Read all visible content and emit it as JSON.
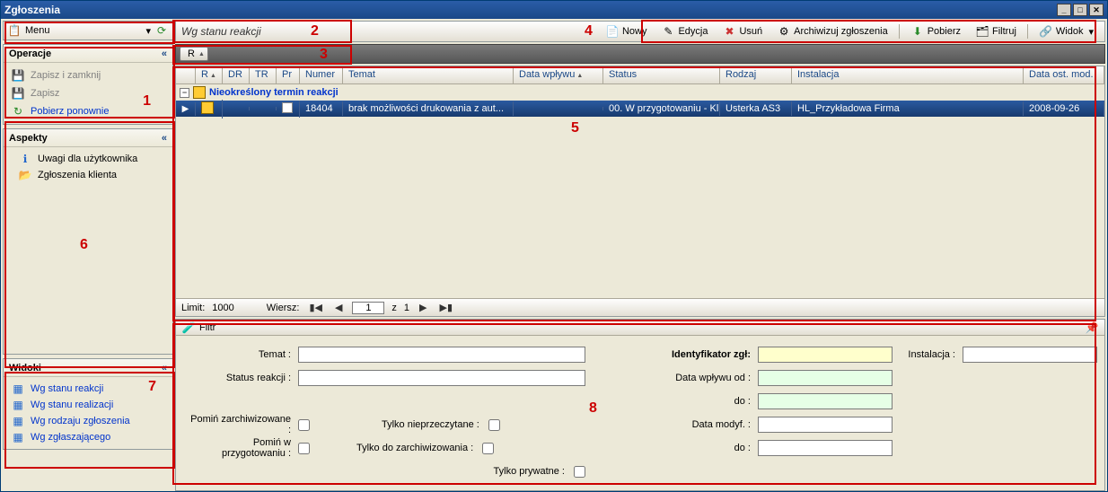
{
  "window": {
    "title": "Zgłoszenia"
  },
  "left": {
    "menu_label": "Menu",
    "operations": {
      "header": "Operacje",
      "items": [
        {
          "label": "Zapisz i zamknij",
          "disabled": true,
          "icon": "💾"
        },
        {
          "label": "Zapisz",
          "disabled": true,
          "icon": "💾"
        },
        {
          "label": "Pobierz ponownie",
          "disabled": false,
          "icon": "↻"
        }
      ]
    },
    "aspects": {
      "header": "Aspekty",
      "items": [
        {
          "label": "Uwagi dla użytkownika",
          "icon": "ℹ"
        },
        {
          "label": "Zgłoszenia klienta",
          "icon": "📂"
        }
      ]
    },
    "views": {
      "header": "Widoki",
      "items": [
        {
          "label": "Wg stanu reakcji"
        },
        {
          "label": "Wg stanu realizacji"
        },
        {
          "label": "Wg rodzaju zgłoszenia"
        },
        {
          "label": "Wg zgłaszającego"
        }
      ]
    }
  },
  "header": {
    "current_view": "Wg stanu reakcji",
    "toolbar": {
      "nowy": "Nowy",
      "edycja": "Edycja",
      "usun": "Usuń",
      "archiwizuj": "Archiwizuj zgłoszenia",
      "pobierz": "Pobierz",
      "filtruj": "Filtruj",
      "widok": "Widok"
    }
  },
  "group_chip": "R",
  "grid": {
    "columns": {
      "r": "R",
      "dr": "DR",
      "tr": "TR",
      "pr": "Pr",
      "numer": "Numer",
      "temat": "Temat",
      "data_wplywu": "Data wpływu",
      "status": "Status",
      "rodzaj": "Rodzaj",
      "instalacja": "Instalacja",
      "data_ost_mod": "Data ost. mod."
    },
    "group_label": "Nieokreślony termin reakcji",
    "rows": [
      {
        "numer": "18404",
        "temat": "brak możliwości drukowania z aut...",
        "data_wplywu": "",
        "status": "00. W przygotowaniu - Kl...",
        "rodzaj": "Usterka AS3",
        "instalacja": "HL_Przykładowa Firma",
        "data_ost_mod": "2008-09-26"
      }
    ],
    "footer": {
      "limit_label": "Limit:",
      "limit_value": "1000",
      "wiersz_label": "Wiersz:",
      "page_current": "1",
      "page_sep": "z",
      "page_total": "1"
    }
  },
  "filter": {
    "title": "Filtr",
    "labels": {
      "temat": "Temat :",
      "status_reakcji": "Status reakcji :",
      "identyfikator": "Identyfikator zgł:",
      "instalacja": "Instalacja :",
      "data_wplywu_od": "Data wpływu od :",
      "do": "do :",
      "data_modyf": "Data modyf. :",
      "pomin_zarch": "Pomiń zarchiwizowane :",
      "pomin_przyg": "Pomiń w przygotowaniu :",
      "tylko_nieprz": "Tylko nieprzeczytane :",
      "tylko_do_arch": "Tylko do zarchiwizowania :",
      "tylko_priv": "Tylko prywatne :"
    }
  },
  "annotations": [
    "1",
    "2",
    "3",
    "4",
    "5",
    "6",
    "7",
    "8"
  ]
}
